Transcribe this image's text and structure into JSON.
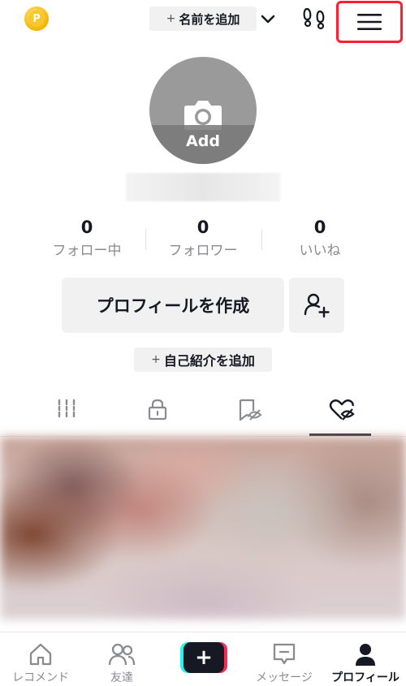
{
  "header": {
    "coin_letter": "P",
    "add_name_plus": "+",
    "add_name_label": "名前を追加"
  },
  "avatar": {
    "add_label": "Add"
  },
  "stats": [
    {
      "value": "0",
      "label": "フォロー中"
    },
    {
      "value": "0",
      "label": "フォロワー"
    },
    {
      "value": "0",
      "label": "いいね"
    }
  ],
  "actions": {
    "create_profile": "プロフィールを作成",
    "add_bio_plus": "+",
    "add_bio": "自己紹介を追加"
  },
  "tabs": [
    {
      "icon": "grid-icon",
      "active": false
    },
    {
      "icon": "lock-icon",
      "active": false
    },
    {
      "icon": "bookmark-hidden-icon",
      "active": false
    },
    {
      "icon": "heart-hidden-icon",
      "active": true
    }
  ],
  "bottom_nav": {
    "home": "レコメンド",
    "friends": "友達",
    "create_plus": "+",
    "inbox": "メッセージ",
    "profile": "プロフィール"
  },
  "colors": {
    "highlight_border": "#ff1e2d",
    "text_primary": "#161823",
    "text_secondary": "#8a8b91",
    "pill_bg": "#f1f1f2",
    "cyan": "#25f4ee",
    "pink": "#fe2c55"
  }
}
